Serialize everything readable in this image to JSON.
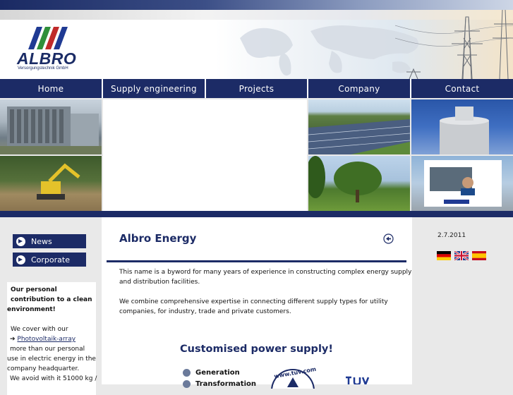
{
  "logo": {
    "word": "ALBRO",
    "sub": "Versorgungstechnik GmbH"
  },
  "nav": [
    "Home",
    "Supply engineering",
    "Projects",
    "Company",
    "Contact"
  ],
  "sidebar": {
    "buttons": [
      "News",
      "Corporate"
    ],
    "box": {
      "heading_lines": [
        "Our personal",
        "contribution to a   clean",
        "environment!"
      ],
      "line1": "We cover with our",
      "link": "Photovoltaik-array",
      "lines": [
        "more than our   personal",
        "use in electric   energy in the",
        "company   headquarter.",
        "We avoid with it   51000 kg /"
      ]
    }
  },
  "main": {
    "title": "Albro Energy",
    "para1_lines": [
      "This name is a byword for many years of experience in constructing complex energy supply",
      "and distribution facilities."
    ],
    "para2_lines": [
      "We combine comprehensive expertise in connecting different supply types for utility",
      "companies, for industry, trade and private customers."
    ],
    "subtitle": "Customised power supply!",
    "bullets": [
      "Generation",
      "Transformation"
    ],
    "badge_url": "www.tuv.com"
  },
  "right": {
    "date": "2.7.2011"
  },
  "colors": {
    "navy": "#1c2b66",
    "accent": "#1f3a93"
  }
}
